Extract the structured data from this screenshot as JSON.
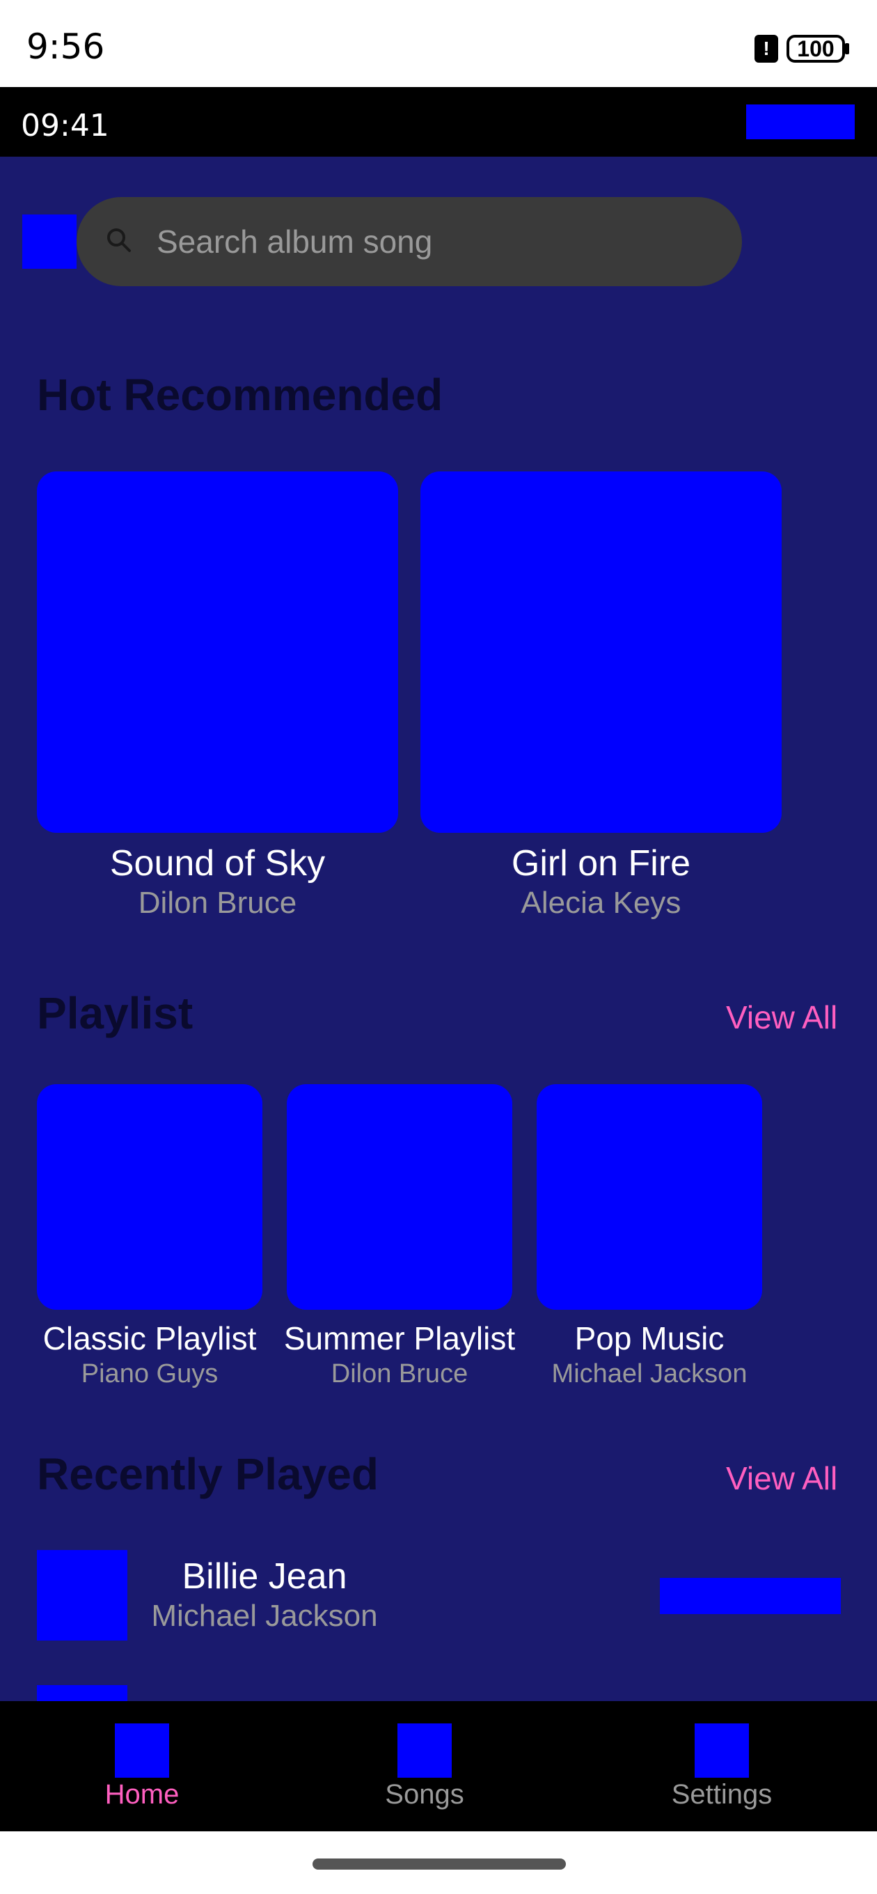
{
  "status_bar": {
    "time": "9:56",
    "alert_glyph": "!",
    "battery": "100"
  },
  "app_bar": {
    "time": "09:41"
  },
  "search": {
    "placeholder": "Search album song"
  },
  "hot": {
    "title": "Hot Recommended",
    "items": [
      {
        "title": "Sound of Sky",
        "artist": "Dilon Bruce"
      },
      {
        "title": "Girl on Fire",
        "artist": "Alecia Keys"
      }
    ]
  },
  "playlist": {
    "title": "Playlist",
    "view_all": "View All",
    "items": [
      {
        "title": "Classic Playlist",
        "artist": "Piano Guys"
      },
      {
        "title": "Summer Playlist",
        "artist": "Dilon Bruce"
      },
      {
        "title": "Pop Music",
        "artist": "Michael Jackson"
      }
    ]
  },
  "recent": {
    "title": "Recently Played",
    "view_all": "View All",
    "items": [
      {
        "title": "Billie Jean",
        "artist": "Michael Jackson"
      }
    ]
  },
  "nav": {
    "items": [
      {
        "label": "Home",
        "active": true
      },
      {
        "label": "Songs",
        "active": false
      },
      {
        "label": "Settings",
        "active": false
      }
    ]
  },
  "colors": {
    "background": "#1a1a6e",
    "placeholder_blue": "#0000ff",
    "accent_pink": "#ff5fc0",
    "muted_text": "#9a9a9a"
  }
}
